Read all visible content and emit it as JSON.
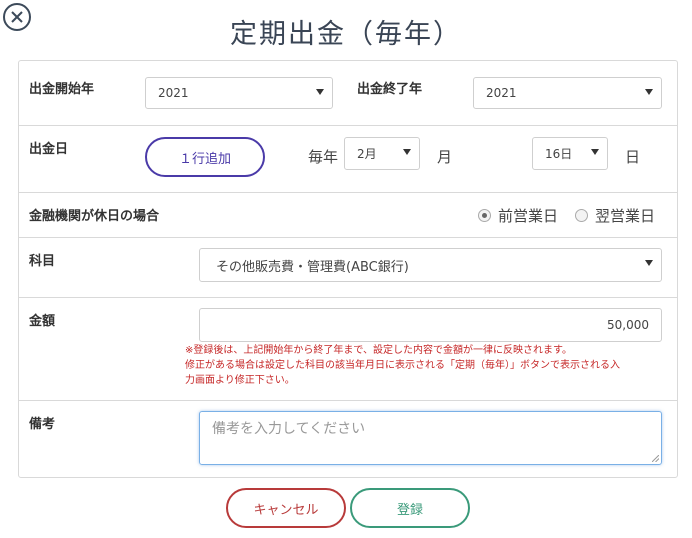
{
  "dialog": {
    "title": "定期出金（毎年）"
  },
  "form": {
    "start_year": {
      "label": "出金開始年",
      "value": "2021"
    },
    "end_year": {
      "label": "出金終了年",
      "value": "2021"
    },
    "date": {
      "label": "出金日",
      "add_row_label": "１行追加",
      "every_year_text": "毎年",
      "month_value": "2月",
      "month_text": "月",
      "day_value": "16日",
      "day_text": "日"
    },
    "holiday": {
      "label": "金融機関が休日の場合",
      "options": [
        {
          "label": "前営業日",
          "selected": true
        },
        {
          "label": "翌営業日",
          "selected": false
        }
      ]
    },
    "account": {
      "label": "科目",
      "value": "その他販売費・管理費(ABC銀行)"
    },
    "amount": {
      "label": "金額",
      "value": "50,000",
      "note_line1": "※登録後は、上記開始年から終了年まで、設定した内容で金額が一律に反映されます。",
      "note_line2": "修正がある場合は設定した科目の該当年月日に表示される「定期（毎年）」ボタンで表示される入",
      "note_line3": "力画面より修正下さい。"
    },
    "memo": {
      "label": "備考",
      "placeholder": "備考を入力してください"
    }
  },
  "buttons": {
    "cancel": "キャンセル",
    "save": "登録"
  },
  "colors": {
    "add_button": "#4a3aa8",
    "cancel": "#b83a3a",
    "save": "#3a9a7a",
    "note": "#c62828"
  }
}
